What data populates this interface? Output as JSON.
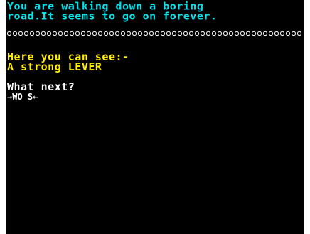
{
  "colors": {
    "background": "#000000",
    "description_text": "#00e5ee",
    "divider": "#ffffff",
    "items_text": "#ffee00",
    "prompt_text": "#ffffff"
  },
  "description": {
    "line1": "You are walking down a boring",
    "line2": "road.It seems to go on forever."
  },
  "visible_items": {
    "heading": "Here you can see:-",
    "item1": "A strong LEVER"
  },
  "prompt": {
    "question": "What next?",
    "input_value": "→WO S←"
  }
}
